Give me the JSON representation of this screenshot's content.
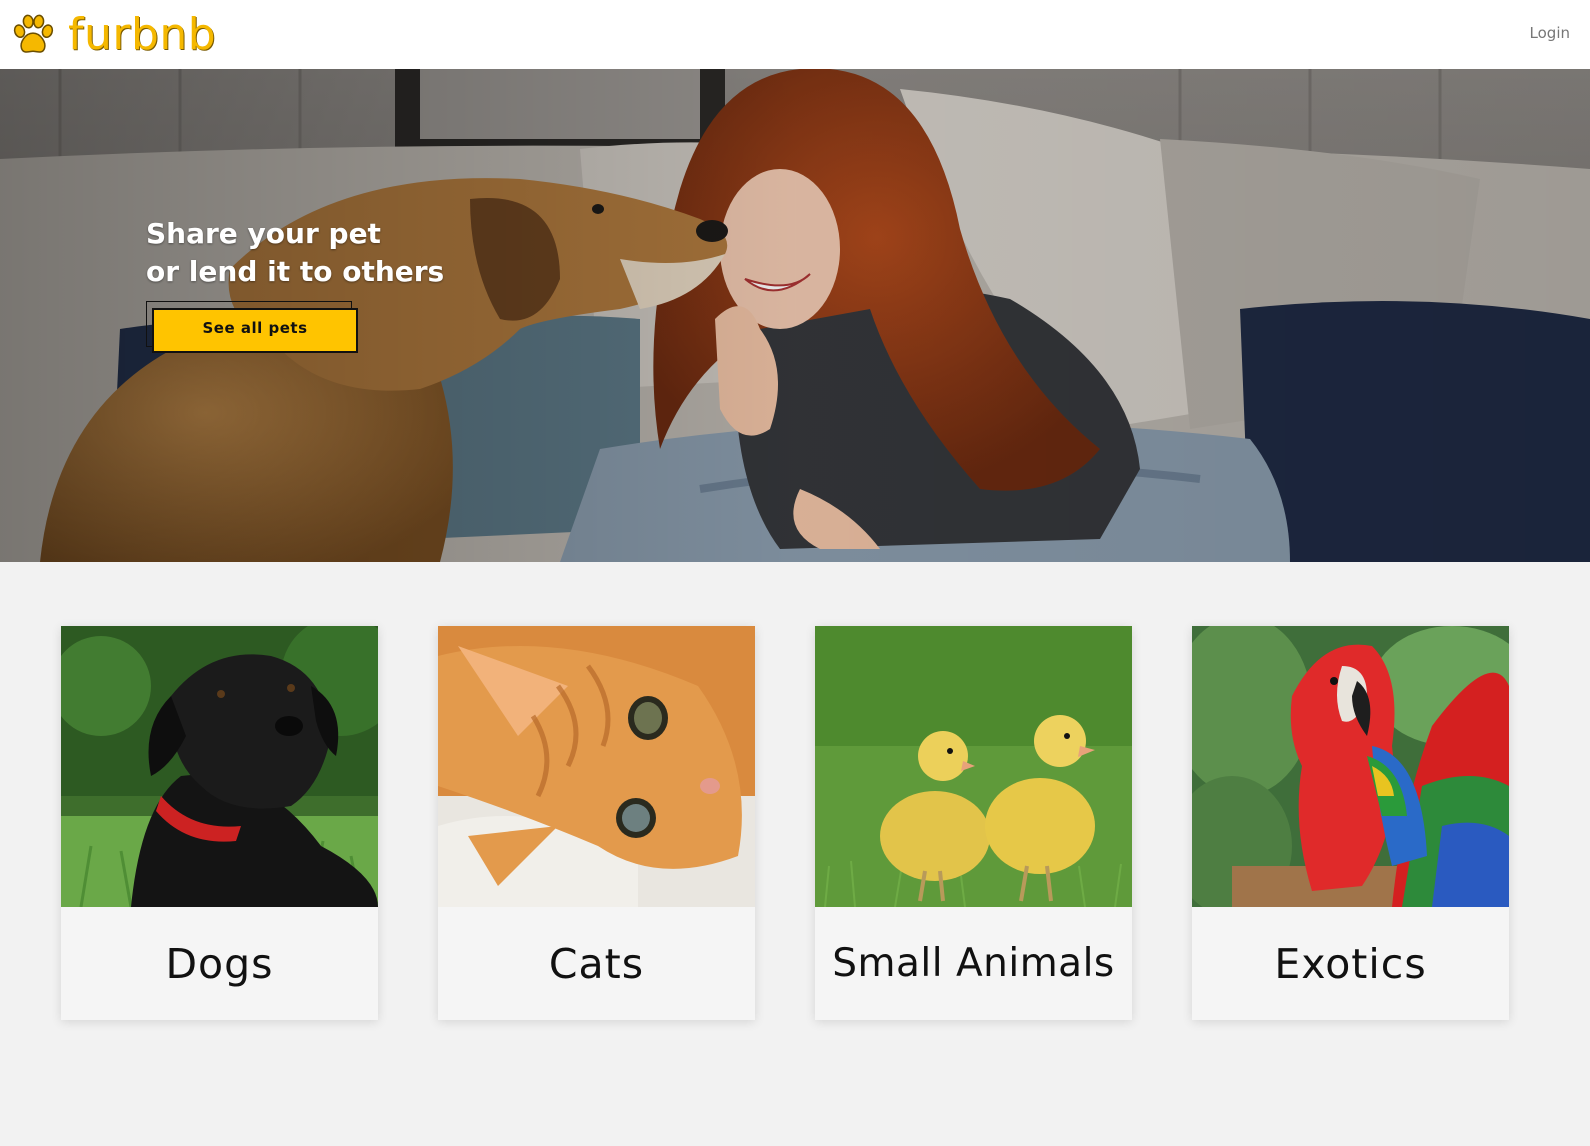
{
  "brand": {
    "name": "furbnb",
    "color": "#f5b800"
  },
  "nav": {
    "login_label": "Login"
  },
  "hero": {
    "title_line1": "Share your pet",
    "title_line2": "or lend it to others",
    "cta_label": "See all pets",
    "cta_color": "#ffc400"
  },
  "categories": [
    {
      "label": "Dogs"
    },
    {
      "label": "Cats"
    },
    {
      "label": "Small Animals"
    },
    {
      "label": "Exotics"
    }
  ]
}
